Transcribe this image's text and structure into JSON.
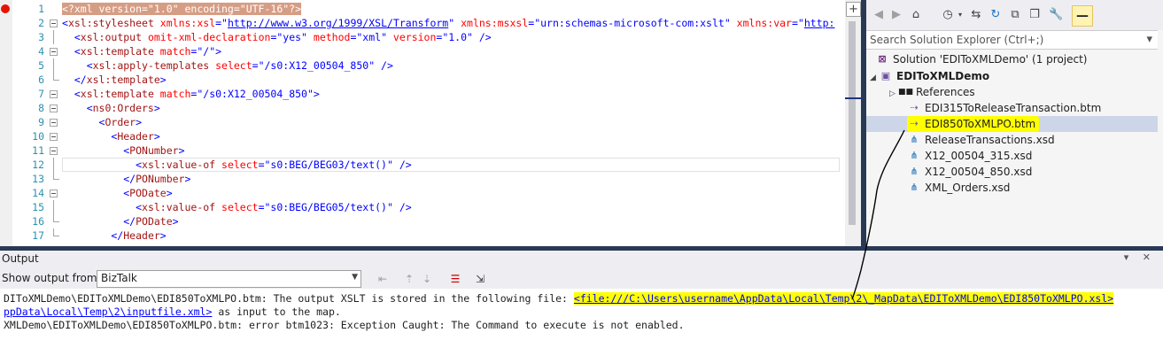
{
  "editor": {
    "line_numbers": [
      "1",
      "2",
      "3",
      "4",
      "5",
      "6",
      "7",
      "8",
      "9",
      "10",
      "11",
      "12",
      "13",
      "14",
      "15",
      "16",
      "17"
    ],
    "lines": [
      [
        {
          "t": "<?xml version=\"1.0\" encoding=\"UTF-16\"?>",
          "c": "pi"
        }
      ],
      [
        {
          "t": "<",
          "c": "b"
        },
        {
          "t": "xsl:stylesheet",
          "c": "m"
        },
        {
          "t": " xmlns:xsl",
          "c": "a"
        },
        {
          "t": "=\"",
          "c": "b"
        },
        {
          "t": "http://www.w3.org/1999/XSL/Transform",
          "c": "u"
        },
        {
          "t": "\"",
          "c": "b"
        },
        {
          "t": " xmlns:msxsl",
          "c": "a"
        },
        {
          "t": "=\"urn:schemas-microsoft-com:xslt\"",
          "c": "b"
        },
        {
          "t": " xmlns:var",
          "c": "a"
        },
        {
          "t": "=\"",
          "c": "b"
        },
        {
          "t": "http:",
          "c": "u"
        }
      ],
      [
        {
          "t": "  <",
          "c": "b"
        },
        {
          "t": "xsl:output",
          "c": "m"
        },
        {
          "t": " omit-xml-declaration",
          "c": "a"
        },
        {
          "t": "=\"yes\"",
          "c": "b"
        },
        {
          "t": " method",
          "c": "a"
        },
        {
          "t": "=\"xml\"",
          "c": "b"
        },
        {
          "t": " version",
          "c": "a"
        },
        {
          "t": "=\"1.0\" />",
          "c": "b"
        }
      ],
      [
        {
          "t": "  <",
          "c": "b"
        },
        {
          "t": "xsl:template",
          "c": "m"
        },
        {
          "t": " match",
          "c": "a"
        },
        {
          "t": "=\"/\">",
          "c": "b"
        }
      ],
      [
        {
          "t": "    <",
          "c": "b"
        },
        {
          "t": "xsl:apply-templates",
          "c": "m"
        },
        {
          "t": " select",
          "c": "a"
        },
        {
          "t": "=\"/s0:X12_00504_850\" />",
          "c": "b"
        }
      ],
      [
        {
          "t": "  </",
          "c": "b"
        },
        {
          "t": "xsl:template",
          "c": "m"
        },
        {
          "t": ">",
          "c": "b"
        }
      ],
      [
        {
          "t": "  <",
          "c": "b"
        },
        {
          "t": "xsl:template",
          "c": "m"
        },
        {
          "t": " match",
          "c": "a"
        },
        {
          "t": "=\"/s0:X12_00504_850\">",
          "c": "b"
        }
      ],
      [
        {
          "t": "    <",
          "c": "b"
        },
        {
          "t": "ns0:Orders",
          "c": "m"
        },
        {
          "t": ">",
          "c": "b"
        }
      ],
      [
        {
          "t": "      <",
          "c": "b"
        },
        {
          "t": "Order",
          "c": "m"
        },
        {
          "t": ">",
          "c": "b"
        }
      ],
      [
        {
          "t": "        <",
          "c": "b"
        },
        {
          "t": "Header",
          "c": "m"
        },
        {
          "t": ">",
          "c": "b"
        }
      ],
      [
        {
          "t": "          <",
          "c": "b"
        },
        {
          "t": "PONumber",
          "c": "m"
        },
        {
          "t": ">",
          "c": "b"
        }
      ],
      [
        {
          "t": "            <",
          "c": "b"
        },
        {
          "t": "xsl:value-of",
          "c": "m"
        },
        {
          "t": " select",
          "c": "a"
        },
        {
          "t": "=\"s0:BEG/BEG03/text()\" />",
          "c": "b"
        }
      ],
      [
        {
          "t": "          </",
          "c": "b"
        },
        {
          "t": "PONumber",
          "c": "m"
        },
        {
          "t": ">",
          "c": "b"
        }
      ],
      [
        {
          "t": "          <",
          "c": "b"
        },
        {
          "t": "PODate",
          "c": "m"
        },
        {
          "t": ">",
          "c": "b"
        }
      ],
      [
        {
          "t": "            <",
          "c": "b"
        },
        {
          "t": "xsl:value-of",
          "c": "m"
        },
        {
          "t": " select",
          "c": "a"
        },
        {
          "t": "=\"s0:BEG/BEG05/text()\" />",
          "c": "b"
        }
      ],
      [
        {
          "t": "          </",
          "c": "b"
        },
        {
          "t": "PODate",
          "c": "m"
        },
        {
          "t": ">",
          "c": "b"
        }
      ],
      [
        {
          "t": "        </",
          "c": "b"
        },
        {
          "t": "Header",
          "c": "m"
        },
        {
          "t": ">",
          "c": "b"
        }
      ]
    ],
    "folds": [
      "",
      "box",
      "line",
      "box",
      "line",
      "end",
      "box",
      "box",
      "box",
      "box",
      "box",
      "line",
      "end",
      "box",
      "line",
      "end",
      "end"
    ],
    "split_icon": "+"
  },
  "solution_explorer": {
    "search_placeholder": "Search Solution Explorer (Ctrl+;)",
    "tree": {
      "solution": "Solution 'EDIToXMLDemo' (1 project)",
      "project": "EDIToXMLDemo",
      "references": "References",
      "items": [
        {
          "label": "EDI315ToReleaseTransaction.btm",
          "icon": "btm-map-icon"
        },
        {
          "label": "EDI850ToXMLPO.btm",
          "icon": "btm-map-icon"
        },
        {
          "label": "ReleaseTransactions.xsd",
          "icon": "xsd-schema-icon"
        },
        {
          "label": "X12_00504_315.xsd",
          "icon": "xsd-schema-icon"
        },
        {
          "label": "X12_00504_850.xsd",
          "icon": "xsd-schema-icon"
        },
        {
          "label": "XML_Orders.xsd",
          "icon": "xsd-schema-icon"
        }
      ]
    }
  },
  "output": {
    "title": "Output",
    "show_from_label": "Show output from:",
    "source": "BizTalk",
    "lines": {
      "l1_pre": "DIToXMLDemo\\EDIToXMLDemo\\EDI850ToXMLPO.btm: The output XSLT is stored in the following file: ",
      "l1_link": "<file:///C:\\Users\\username\\AppData\\Local\\Temp\\2\\_MapData\\EDIToXMLDemo\\EDI850ToXMLPO.xsl>",
      "l2_link": "ppData\\Local\\Temp\\2\\inputfile.xml>",
      "l2_post": " as input to the map.",
      "l3": "XMLDemo\\EDIToXMLDemo\\EDI850ToXMLPO.btm: error btm1023: Exception Caught: The Command to execute is not enabled."
    }
  },
  "colors": {
    "highlight": "#ffff00",
    "line_number": "#2b91af",
    "frame": "#293955"
  }
}
